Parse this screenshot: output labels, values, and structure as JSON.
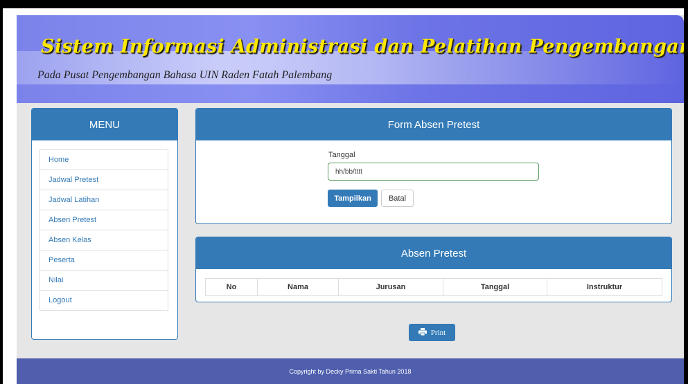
{
  "header": {
    "title": "Sistem Informasi Administrasi dan Pelatihan Pengembangan Bahasa",
    "subtitle": "Pada Pusat Pengembangan Bahasa UIN Raden  Fatah Palembang",
    "title_color": "#ffe800"
  },
  "sidebar": {
    "title": "MENU",
    "items": [
      {
        "label": "Home"
      },
      {
        "label": "Jadwal Pretest"
      },
      {
        "label": "Jadwal Latihan"
      },
      {
        "label": "Absen Pretest"
      },
      {
        "label": "Absen Kelas"
      },
      {
        "label": "Peserta"
      },
      {
        "label": "Nilai"
      },
      {
        "label": "Logout"
      }
    ]
  },
  "form_panel": {
    "title": "Form Absen Pretest",
    "date_label": "Tanggal",
    "date_placeholder": "hh/bb/tttt",
    "submit_label": "Tampilkan",
    "cancel_label": "Batal"
  },
  "table_panel": {
    "title": "Absen Pretest",
    "columns": [
      "No",
      "Nama",
      "Jurusan",
      "Tanggal",
      "Instruktur"
    ]
  },
  "print": {
    "label": "Print",
    "icon": "printer-icon"
  },
  "footer": {
    "text": "Copyright by Decky Prima Sakti Tahun 2018"
  },
  "colors": {
    "primary": "#337ab7",
    "footer": "#4f5fae",
    "header": "#7b83ea"
  }
}
